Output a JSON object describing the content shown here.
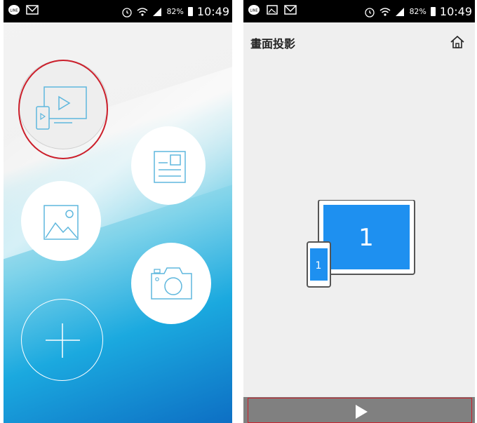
{
  "status_bar": {
    "battery_percent": "82%",
    "time": "10:49"
  },
  "screen_left": {
    "buttons": [
      {
        "name": "screen-projection",
        "icon": "tv-phone-play-icon",
        "highlighted": true
      },
      {
        "name": "document",
        "icon": "document-icon"
      },
      {
        "name": "photo",
        "icon": "image-icon"
      },
      {
        "name": "camera",
        "icon": "camera-icon"
      },
      {
        "name": "add",
        "icon": "plus-icon"
      }
    ]
  },
  "screen_right": {
    "title": "畫面投影",
    "home_icon": "home-icon",
    "tablet_label": "1",
    "phone_label": "1",
    "play_icon": "play-icon"
  },
  "colors": {
    "accent_blue": "#1e90f0",
    "highlight_red": "#cc1f2b",
    "icon_line": "#5fb7dd"
  }
}
